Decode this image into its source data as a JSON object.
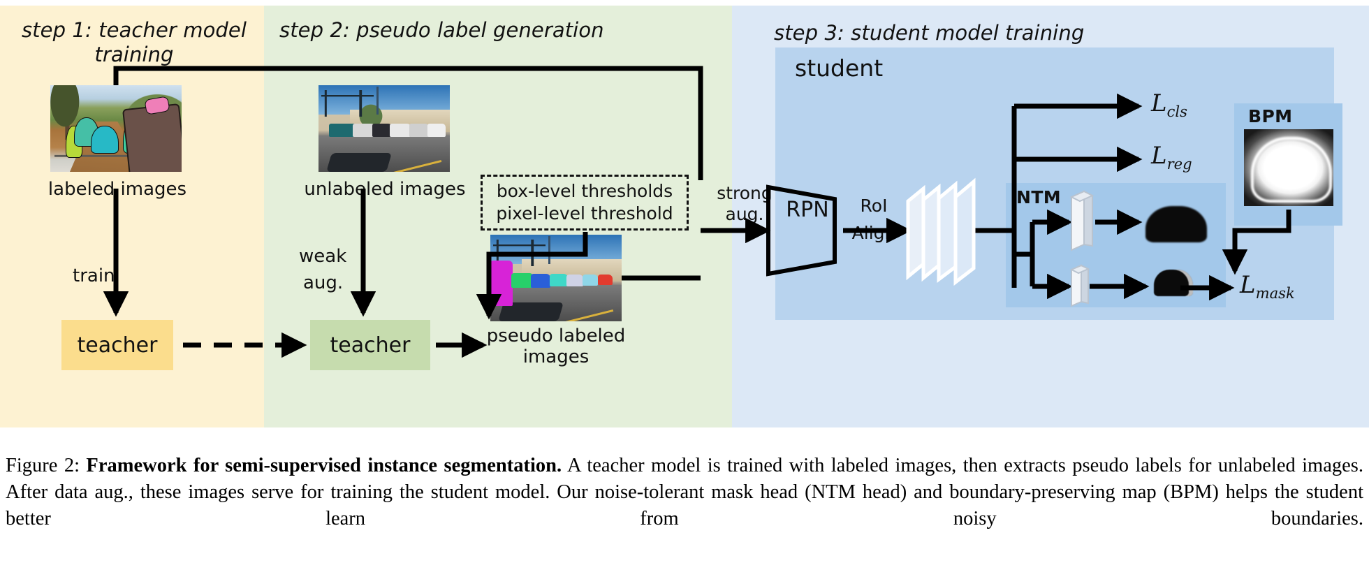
{
  "figure": {
    "panels": [
      {
        "id": "step1",
        "title": "step 1: teacher model training",
        "bg": "#fdf2d2"
      },
      {
        "id": "step2",
        "title": "step 2: pseudo label generation",
        "bg": "#e4efda"
      },
      {
        "id": "step3",
        "title": "step 3: student model training",
        "bg": "#dce8f6"
      }
    ],
    "step1": {
      "image_caption": "labeled images",
      "arrow_label": "train",
      "model_box": "teacher"
    },
    "step2": {
      "image_caption": "unlabeled images",
      "arrow_label_line1": "weak",
      "arrow_label_line2": "aug.",
      "model_box": "teacher",
      "threshold_box": {
        "line1": "box-level thresholds",
        "line2": "pixel-level threshold"
      },
      "output_caption": "pseudo labeled images"
    },
    "step3": {
      "student_label": "student",
      "strong_aug_line1": "strong",
      "strong_aug_line2": "aug.",
      "rpn_label": "RPN",
      "roi_align_line1": "RoI",
      "roi_align_line2": "Align",
      "ntm_label": "NTM",
      "bpm_label": "BPM",
      "losses": [
        {
          "name": "loss-cls",
          "base": "L",
          "sub": "cls"
        },
        {
          "name": "loss-reg",
          "base": "L",
          "sub": "reg"
        },
        {
          "name": "loss-mask",
          "base": "L",
          "sub": "mask"
        }
      ]
    },
    "colors": {
      "step1_bg": "#fdf2d2",
      "step2_bg": "#e4efda",
      "step3_bg": "#dce8f6",
      "student_bg": "#b8d3ee",
      "ntm_bpm_bg": "#a3c8ea",
      "teacher1_box": "#fbdd8d",
      "teacher2_box": "#c6dcae",
      "arrow": "#000000"
    }
  },
  "caption": {
    "prefix": "Figure 2: ",
    "bold": "Framework for semi-supervised instance segmentation.",
    "body": " A teacher model is trained with labeled images, then extracts pseudo labels for unlabeled images. After data aug., these images serve for training the student model. Our noise-tolerant mask head (NTM head) and boundary-preserving map (BPM) helps the student better learn from noisy boundaries."
  }
}
